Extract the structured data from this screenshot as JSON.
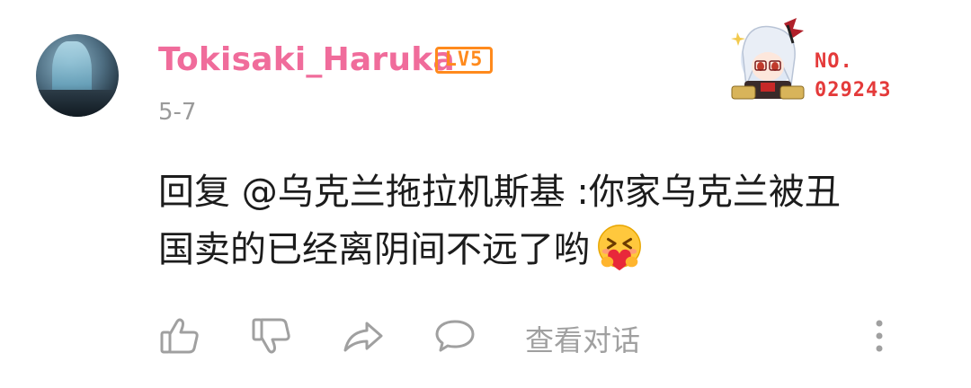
{
  "comment": {
    "username": "Tokisaki_Haruka",
    "level": "LV5",
    "date": "5-7",
    "text_line1": "回复 @乌克兰拖拉机斯基 :你家乌克兰被丑",
    "text_line2": "国卖的已经离阴间不远了哟"
  },
  "badge": {
    "label": "NO.",
    "number": "029243"
  },
  "actions": {
    "like_icon": "thumbs-up-icon",
    "dislike_icon": "thumbs-down-icon",
    "share_icon": "share-icon",
    "reply_icon": "comment-bubble-icon",
    "view_conversation": "查看对话",
    "more_icon": "more-vertical-icon"
  },
  "colors": {
    "username": "#f06c9b",
    "level": "#ff8a1d",
    "badge": "#e43a3a",
    "icon_gray": "#a0a0a0"
  }
}
